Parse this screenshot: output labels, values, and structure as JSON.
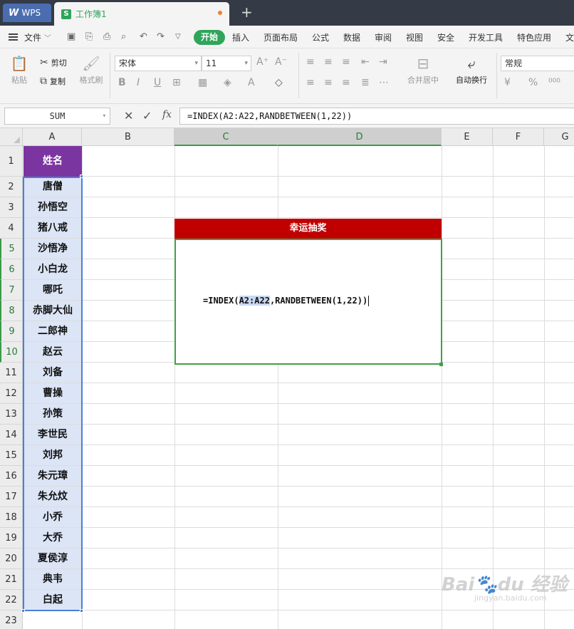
{
  "tabs": {
    "app_tab": "WPS",
    "doc_tab": "工作簿1",
    "new_tab": "+"
  },
  "menu": {
    "file": "文件",
    "start": "开始",
    "items": [
      "插入",
      "页面布局",
      "公式",
      "数据",
      "审阅",
      "视图",
      "安全",
      "开发工具",
      "特色应用",
      "文"
    ]
  },
  "ribbon": {
    "paste": "粘贴",
    "cut": "剪切",
    "copy": "复制",
    "format_painter": "格式刷",
    "font_name": "宋体",
    "font_size": "11",
    "merge_center": "合并居中",
    "wrap_text": "自动换行",
    "number_format": "常规"
  },
  "formula_bar": {
    "name_box": "SUM",
    "fx": "fx",
    "formula": "=INDEX(A2:A22,RANDBETWEEN(1,22))"
  },
  "columns": [
    "A",
    "B",
    "C",
    "D",
    "E",
    "F",
    "G"
  ],
  "rows": [
    "1",
    "2",
    "3",
    "4",
    "5",
    "6",
    "7",
    "8",
    "9",
    "10",
    "11",
    "12",
    "13",
    "14",
    "15",
    "16",
    "17",
    "18",
    "19",
    "20",
    "21",
    "22",
    "23"
  ],
  "sheet": {
    "header": "姓名",
    "names": [
      "唐僧",
      "孙悟空",
      "猪八戒",
      "沙悟净",
      "小白龙",
      "哪吒",
      "赤脚大仙",
      "二郎神",
      "赵云",
      "刘备",
      "曹操",
      "孙策",
      "李世民",
      "刘邦",
      "朱元璋",
      "朱允炆",
      "小乔",
      "大乔",
      "夏侯淳",
      "典韦",
      "白起"
    ],
    "banner": "幸运抽奖",
    "edit_formula": {
      "prefix": "=INDEX(",
      "range": "A2:A22",
      "middle": ",RANDBETWEEN(",
      "args": "1,22",
      "suffix": "))"
    }
  },
  "colors": {
    "accent_green": "#2fa55a",
    "header_purple": "#7b35a0",
    "banner_red": "#c00000",
    "selection_blue": "#4a7fd6"
  }
}
